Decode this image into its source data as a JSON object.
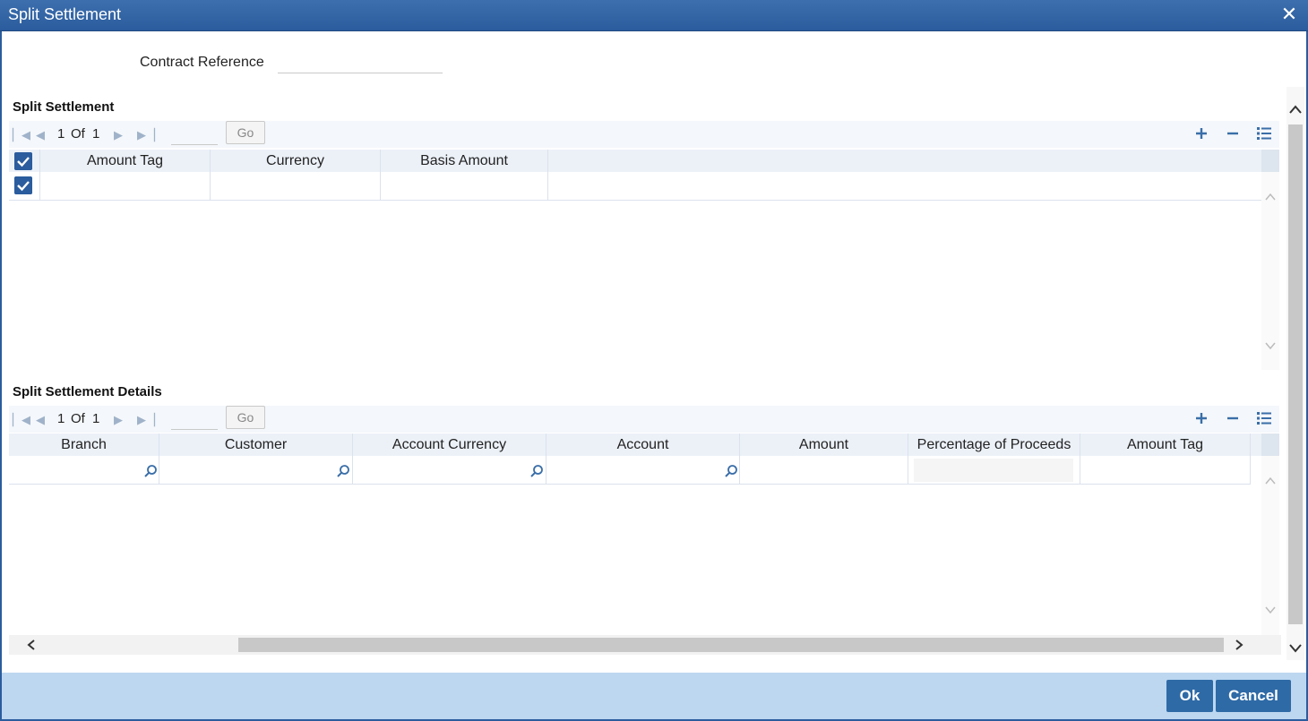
{
  "window": {
    "title": "Split Settlement"
  },
  "header": {
    "contract_reference_label": "Contract Reference",
    "contract_reference_value": ""
  },
  "split_settlement": {
    "title": "Split Settlement",
    "pager": {
      "current": "1",
      "of_label": "Of",
      "total": "1",
      "page_input": "",
      "go_label": "Go"
    },
    "columns": [
      "Amount Tag",
      "Currency",
      "Basis Amount"
    ],
    "rows": [
      {
        "amount_tag": "",
        "currency": "",
        "basis_amount": ""
      }
    ]
  },
  "split_settlement_details": {
    "title": "Split Settlement Details",
    "pager": {
      "current": "1",
      "of_label": "Of",
      "total": "1",
      "page_input": "",
      "go_label": "Go"
    },
    "columns": [
      "Branch",
      "Customer",
      "Account Currency",
      "Account",
      "Amount",
      "Percentage of Proceeds",
      "Amount Tag"
    ],
    "rows": [
      {
        "branch": "",
        "customer": "",
        "account_currency": "",
        "account": "",
        "amount": "",
        "percentage_of_proceeds": "",
        "amount_tag": ""
      }
    ]
  },
  "footer": {
    "ok_label": "Ok",
    "cancel_label": "Cancel"
  },
  "colors": {
    "title_bar": "#2b5c9d",
    "footer": "#bdd7f0",
    "button": "#2e6aa6",
    "header_row": "#ecf1f8"
  }
}
